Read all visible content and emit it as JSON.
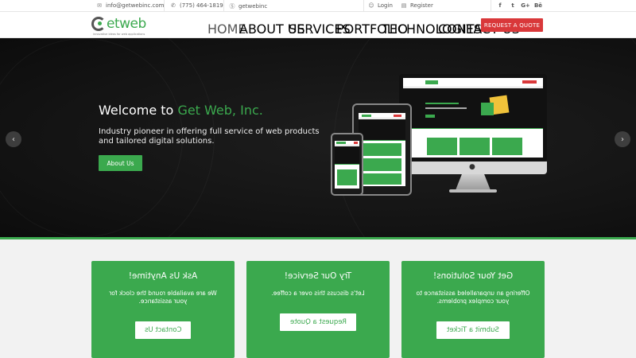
{
  "topbar": {
    "email": "info@getwebinc.com",
    "phone": "(775) 464-1819",
    "skype": "getwebinc",
    "login": "Login",
    "register": "Register",
    "social": [
      "f",
      "t",
      "G+",
      "Bē"
    ]
  },
  "header": {
    "logo_text": "etweb",
    "logo_tagline": "innovative ideas for web applications",
    "nav": [
      "HOME",
      "ABOUT US",
      "SERVICES",
      "PORTFOLIO",
      "TECHNOLOGIES",
      "CONTACT US"
    ],
    "cta": "REQUEST A QUOTE"
  },
  "hero": {
    "title_prefix": "Welcome to",
    "title_highlight": "Get Web, Inc.",
    "subtitle": "Industry pioneer in offering full service of web products and tailored digital solutions.",
    "button": "About Us"
  },
  "cards": [
    {
      "title": "Ask Us Anytime!",
      "text": "We are available round the clock for your assistance.",
      "button": "Contact Us"
    },
    {
      "title": "Try Our Service!",
      "text": "Let's discuss this over a coffee.",
      "button": "Request a Quote"
    },
    {
      "title": "Get Your Solutions!",
      "text": "Offering an unparalleled assistance to your complex problems.",
      "button": "Submit a Ticket"
    }
  ],
  "colors": {
    "brand_green": "#3ba94e",
    "cta_red": "#d9383a",
    "hero_dark": "#141414"
  }
}
